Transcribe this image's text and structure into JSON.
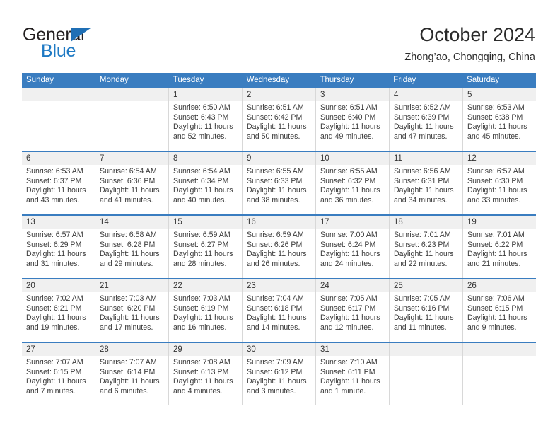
{
  "brand": {
    "name_top": "General",
    "name_bottom": "Blue"
  },
  "header": {
    "month_title": "October 2024",
    "location": "Zhong’ao, Chongqing, China"
  },
  "colors": {
    "header_blue": "#3a7dc0",
    "logo_blue": "#1f7ac4",
    "daynum_strip": "#f0f0f0",
    "cell_border": "#d8d8d8"
  },
  "calendar": {
    "weekday_headers": [
      "Sunday",
      "Monday",
      "Tuesday",
      "Wednesday",
      "Thursday",
      "Friday",
      "Saturday"
    ],
    "labels": {
      "sunrise": "Sunrise:",
      "sunset": "Sunset:",
      "daylight": "Daylight:"
    },
    "weeks": [
      [
        {
          "day": "",
          "empty": true,
          "sunrise": "",
          "sunset": "",
          "daylight_line1": "",
          "daylight_line2": ""
        },
        {
          "day": "",
          "empty": true,
          "sunrise": "",
          "sunset": "",
          "daylight_line1": "",
          "daylight_line2": ""
        },
        {
          "day": "1",
          "empty": false,
          "sunrise": "Sunrise: 6:50 AM",
          "sunset": "Sunset: 6:43 PM",
          "daylight_line1": "Daylight: 11 hours",
          "daylight_line2": "and 52 minutes."
        },
        {
          "day": "2",
          "empty": false,
          "sunrise": "Sunrise: 6:51 AM",
          "sunset": "Sunset: 6:42 PM",
          "daylight_line1": "Daylight: 11 hours",
          "daylight_line2": "and 50 minutes."
        },
        {
          "day": "3",
          "empty": false,
          "sunrise": "Sunrise: 6:51 AM",
          "sunset": "Sunset: 6:40 PM",
          "daylight_line1": "Daylight: 11 hours",
          "daylight_line2": "and 49 minutes."
        },
        {
          "day": "4",
          "empty": false,
          "sunrise": "Sunrise: 6:52 AM",
          "sunset": "Sunset: 6:39 PM",
          "daylight_line1": "Daylight: 11 hours",
          "daylight_line2": "and 47 minutes."
        },
        {
          "day": "5",
          "empty": false,
          "sunrise": "Sunrise: 6:53 AM",
          "sunset": "Sunset: 6:38 PM",
          "daylight_line1": "Daylight: 11 hours",
          "daylight_line2": "and 45 minutes."
        }
      ],
      [
        {
          "day": "6",
          "empty": false,
          "sunrise": "Sunrise: 6:53 AM",
          "sunset": "Sunset: 6:37 PM",
          "daylight_line1": "Daylight: 11 hours",
          "daylight_line2": "and 43 minutes."
        },
        {
          "day": "7",
          "empty": false,
          "sunrise": "Sunrise: 6:54 AM",
          "sunset": "Sunset: 6:36 PM",
          "daylight_line1": "Daylight: 11 hours",
          "daylight_line2": "and 41 minutes."
        },
        {
          "day": "8",
          "empty": false,
          "sunrise": "Sunrise: 6:54 AM",
          "sunset": "Sunset: 6:34 PM",
          "daylight_line1": "Daylight: 11 hours",
          "daylight_line2": "and 40 minutes."
        },
        {
          "day": "9",
          "empty": false,
          "sunrise": "Sunrise: 6:55 AM",
          "sunset": "Sunset: 6:33 PM",
          "daylight_line1": "Daylight: 11 hours",
          "daylight_line2": "and 38 minutes."
        },
        {
          "day": "10",
          "empty": false,
          "sunrise": "Sunrise: 6:55 AM",
          "sunset": "Sunset: 6:32 PM",
          "daylight_line1": "Daylight: 11 hours",
          "daylight_line2": "and 36 minutes."
        },
        {
          "day": "11",
          "empty": false,
          "sunrise": "Sunrise: 6:56 AM",
          "sunset": "Sunset: 6:31 PM",
          "daylight_line1": "Daylight: 11 hours",
          "daylight_line2": "and 34 minutes."
        },
        {
          "day": "12",
          "empty": false,
          "sunrise": "Sunrise: 6:57 AM",
          "sunset": "Sunset: 6:30 PM",
          "daylight_line1": "Daylight: 11 hours",
          "daylight_line2": "and 33 minutes."
        }
      ],
      [
        {
          "day": "13",
          "empty": false,
          "sunrise": "Sunrise: 6:57 AM",
          "sunset": "Sunset: 6:29 PM",
          "daylight_line1": "Daylight: 11 hours",
          "daylight_line2": "and 31 minutes."
        },
        {
          "day": "14",
          "empty": false,
          "sunrise": "Sunrise: 6:58 AM",
          "sunset": "Sunset: 6:28 PM",
          "daylight_line1": "Daylight: 11 hours",
          "daylight_line2": "and 29 minutes."
        },
        {
          "day": "15",
          "empty": false,
          "sunrise": "Sunrise: 6:59 AM",
          "sunset": "Sunset: 6:27 PM",
          "daylight_line1": "Daylight: 11 hours",
          "daylight_line2": "and 28 minutes."
        },
        {
          "day": "16",
          "empty": false,
          "sunrise": "Sunrise: 6:59 AM",
          "sunset": "Sunset: 6:26 PM",
          "daylight_line1": "Daylight: 11 hours",
          "daylight_line2": "and 26 minutes."
        },
        {
          "day": "17",
          "empty": false,
          "sunrise": "Sunrise: 7:00 AM",
          "sunset": "Sunset: 6:24 PM",
          "daylight_line1": "Daylight: 11 hours",
          "daylight_line2": "and 24 minutes."
        },
        {
          "day": "18",
          "empty": false,
          "sunrise": "Sunrise: 7:01 AM",
          "sunset": "Sunset: 6:23 PM",
          "daylight_line1": "Daylight: 11 hours",
          "daylight_line2": "and 22 minutes."
        },
        {
          "day": "19",
          "empty": false,
          "sunrise": "Sunrise: 7:01 AM",
          "sunset": "Sunset: 6:22 PM",
          "daylight_line1": "Daylight: 11 hours",
          "daylight_line2": "and 21 minutes."
        }
      ],
      [
        {
          "day": "20",
          "empty": false,
          "sunrise": "Sunrise: 7:02 AM",
          "sunset": "Sunset: 6:21 PM",
          "daylight_line1": "Daylight: 11 hours",
          "daylight_line2": "and 19 minutes."
        },
        {
          "day": "21",
          "empty": false,
          "sunrise": "Sunrise: 7:03 AM",
          "sunset": "Sunset: 6:20 PM",
          "daylight_line1": "Daylight: 11 hours",
          "daylight_line2": "and 17 minutes."
        },
        {
          "day": "22",
          "empty": false,
          "sunrise": "Sunrise: 7:03 AM",
          "sunset": "Sunset: 6:19 PM",
          "daylight_line1": "Daylight: 11 hours",
          "daylight_line2": "and 16 minutes."
        },
        {
          "day": "23",
          "empty": false,
          "sunrise": "Sunrise: 7:04 AM",
          "sunset": "Sunset: 6:18 PM",
          "daylight_line1": "Daylight: 11 hours",
          "daylight_line2": "and 14 minutes."
        },
        {
          "day": "24",
          "empty": false,
          "sunrise": "Sunrise: 7:05 AM",
          "sunset": "Sunset: 6:17 PM",
          "daylight_line1": "Daylight: 11 hours",
          "daylight_line2": "and 12 minutes."
        },
        {
          "day": "25",
          "empty": false,
          "sunrise": "Sunrise: 7:05 AM",
          "sunset": "Sunset: 6:16 PM",
          "daylight_line1": "Daylight: 11 hours",
          "daylight_line2": "and 11 minutes."
        },
        {
          "day": "26",
          "empty": false,
          "sunrise": "Sunrise: 7:06 AM",
          "sunset": "Sunset: 6:15 PM",
          "daylight_line1": "Daylight: 11 hours",
          "daylight_line2": "and 9 minutes."
        }
      ],
      [
        {
          "day": "27",
          "empty": false,
          "sunrise": "Sunrise: 7:07 AM",
          "sunset": "Sunset: 6:15 PM",
          "daylight_line1": "Daylight: 11 hours",
          "daylight_line2": "and 7 minutes."
        },
        {
          "day": "28",
          "empty": false,
          "sunrise": "Sunrise: 7:07 AM",
          "sunset": "Sunset: 6:14 PM",
          "daylight_line1": "Daylight: 11 hours",
          "daylight_line2": "and 6 minutes."
        },
        {
          "day": "29",
          "empty": false,
          "sunrise": "Sunrise: 7:08 AM",
          "sunset": "Sunset: 6:13 PM",
          "daylight_line1": "Daylight: 11 hours",
          "daylight_line2": "and 4 minutes."
        },
        {
          "day": "30",
          "empty": false,
          "sunrise": "Sunrise: 7:09 AM",
          "sunset": "Sunset: 6:12 PM",
          "daylight_line1": "Daylight: 11 hours",
          "daylight_line2": "and 3 minutes."
        },
        {
          "day": "31",
          "empty": false,
          "sunrise": "Sunrise: 7:10 AM",
          "sunset": "Sunset: 6:11 PM",
          "daylight_line1": "Daylight: 11 hours",
          "daylight_line2": "and 1 minute."
        },
        {
          "day": "",
          "empty": true,
          "sunrise": "",
          "sunset": "",
          "daylight_line1": "",
          "daylight_line2": ""
        },
        {
          "day": "",
          "empty": true,
          "sunrise": "",
          "sunset": "",
          "daylight_line1": "",
          "daylight_line2": ""
        }
      ]
    ]
  }
}
